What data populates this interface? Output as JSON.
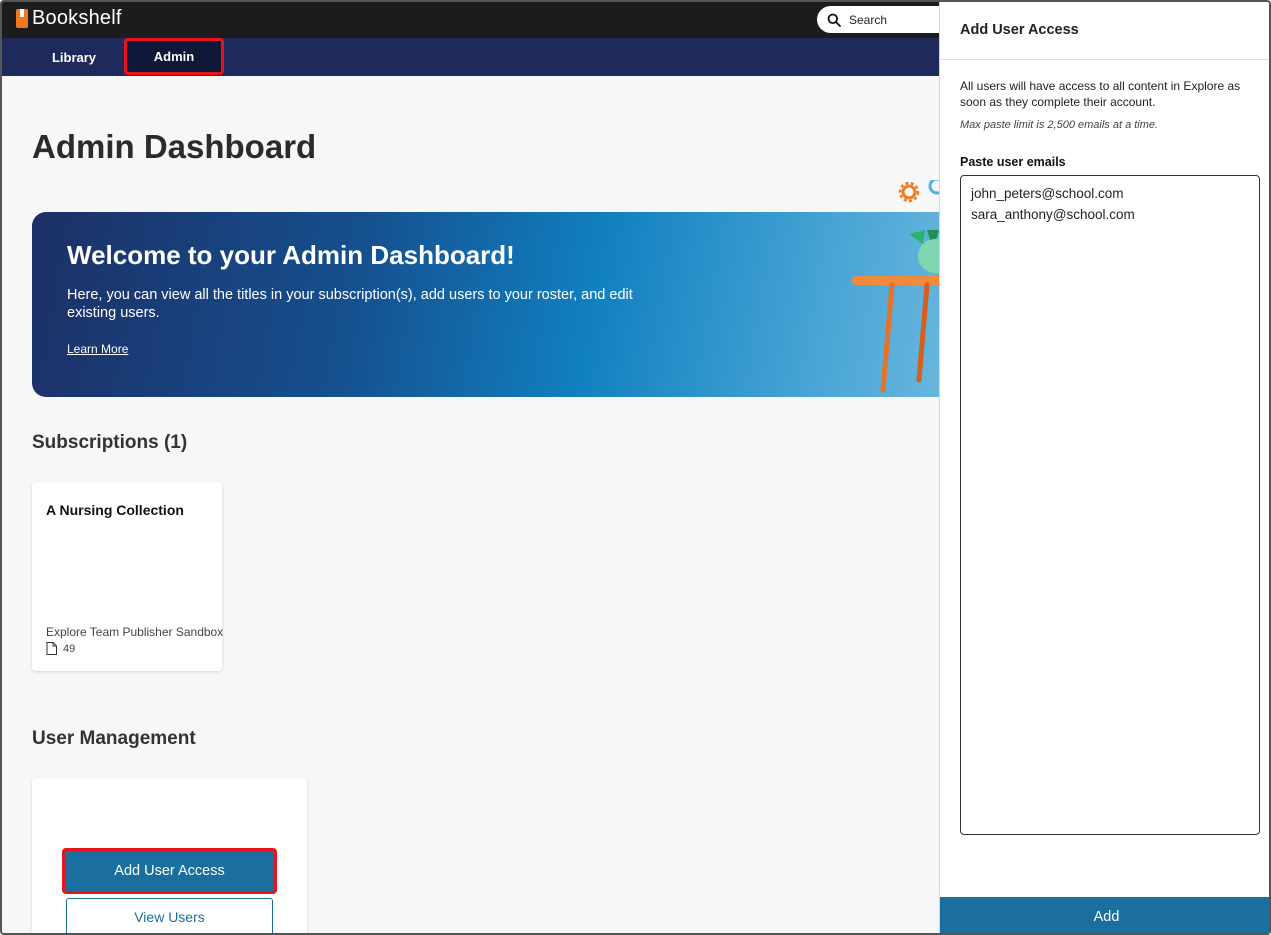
{
  "app": {
    "name": "Bookshelf"
  },
  "search": {
    "label": "Search"
  },
  "nav": {
    "items": [
      {
        "label": "Library"
      },
      {
        "label": "Admin",
        "active": true
      }
    ]
  },
  "page": {
    "title": "Admin Dashboard"
  },
  "banner": {
    "title": "Welcome to your Admin Dashboard!",
    "text": "Here, you can view all the titles in your subscription(s), add users to your roster, and edit existing users.",
    "link": "Learn More"
  },
  "subscriptions": {
    "title": "Subscriptions (1)",
    "items": [
      {
        "name": "A Nursing Collection",
        "publisher": "Explore Team Publisher Sandbox",
        "count": "49"
      }
    ]
  },
  "user_management": {
    "title": "User Management",
    "add_access_label": "Add User Access",
    "view_users_label": "View Users"
  },
  "panel": {
    "title": "Add User Access",
    "description": "All users will have access to all content in Explore as soon as they complete their account.",
    "note": "Max paste limit is 2,500 emails at a time.",
    "field_label": "Paste user emails",
    "emails": [
      "john_peters@school.com",
      "sara_anthony@school.com"
    ],
    "add_label": "Add"
  },
  "colors": {
    "accent": "#1a6f9f",
    "nav": "#1e2a5c",
    "highlight": "#e8131b",
    "brand": "#f07a22"
  }
}
